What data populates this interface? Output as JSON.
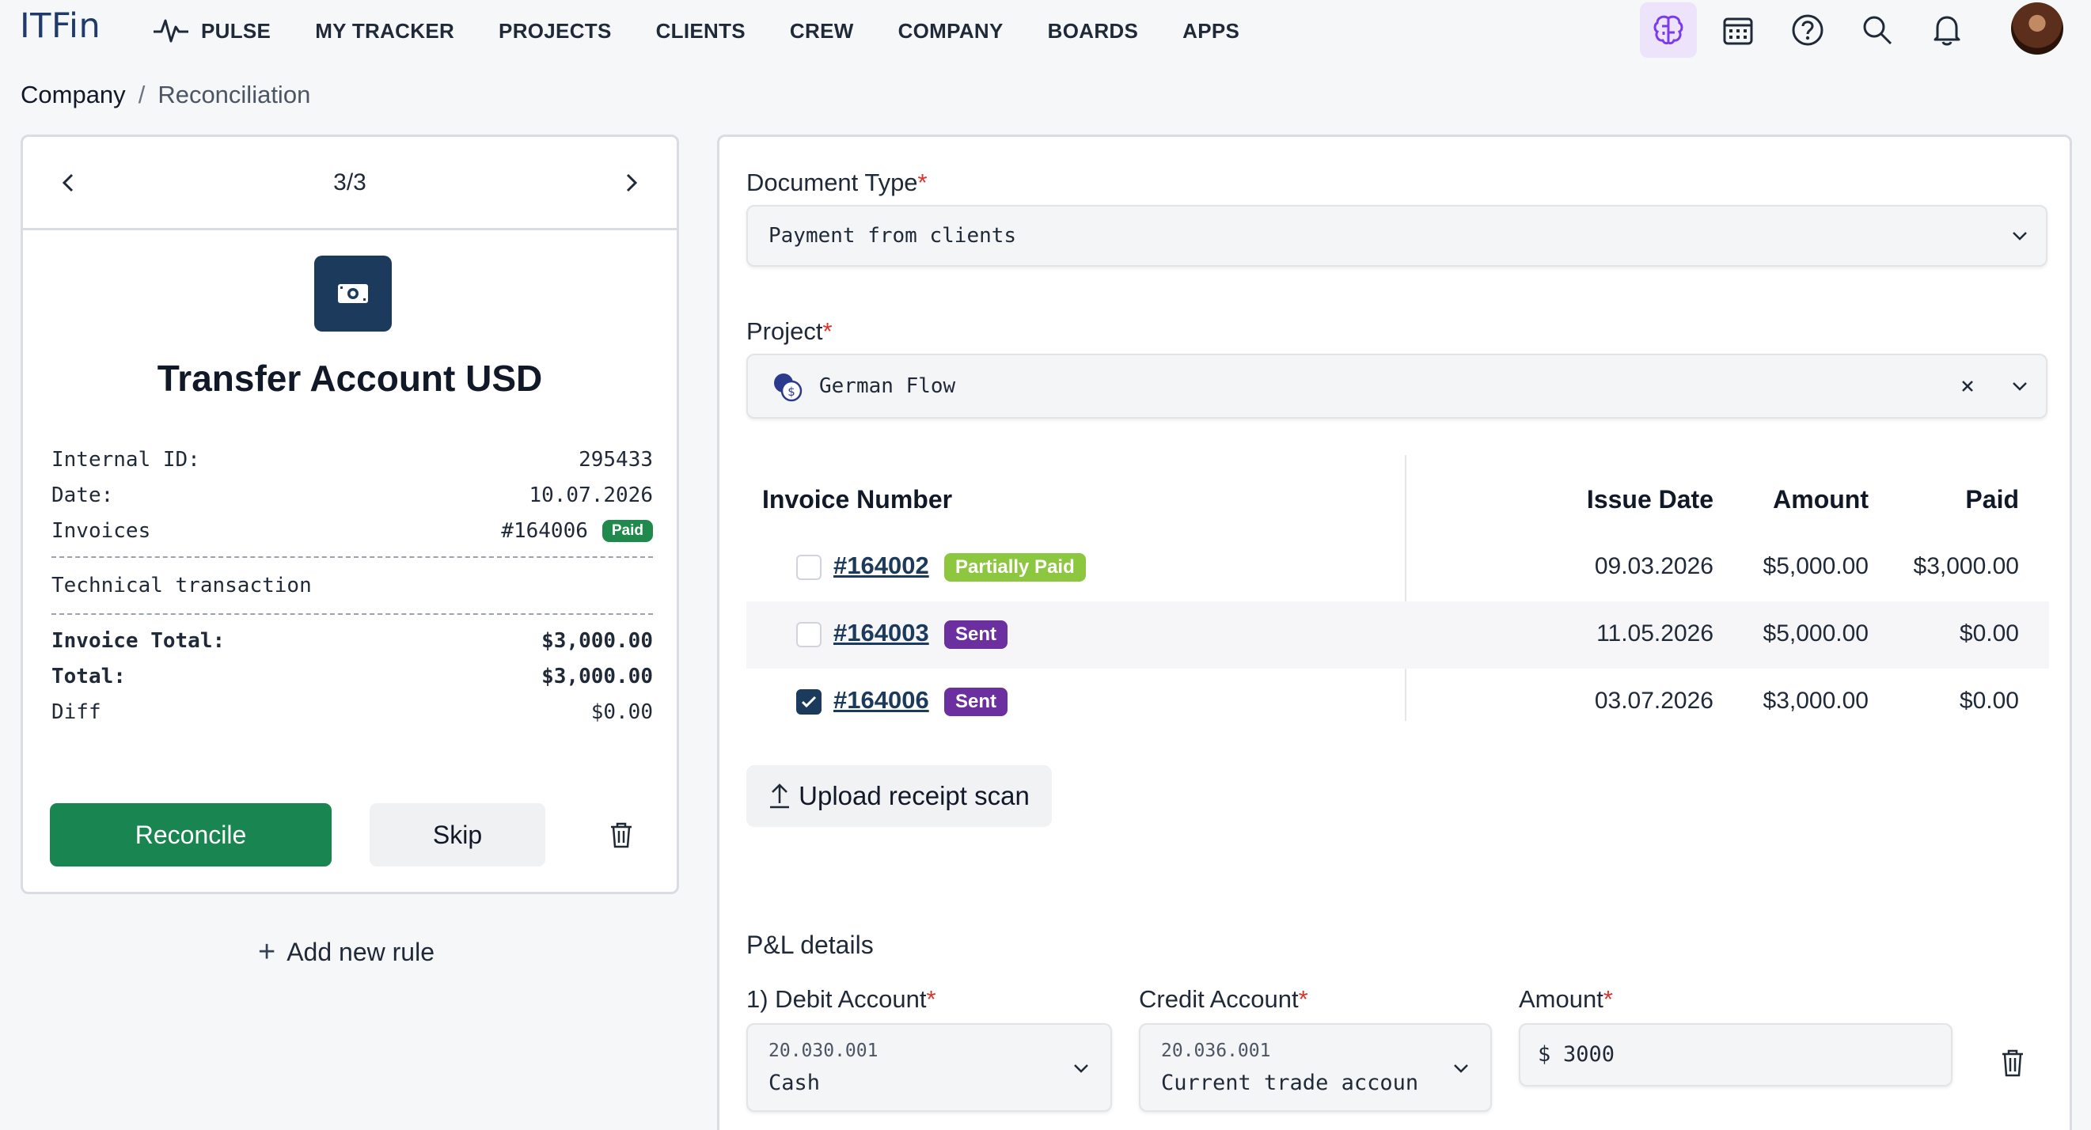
{
  "app": {
    "logo": "ITFin"
  },
  "nav": {
    "items": [
      {
        "label": "PULSE",
        "icon": "pulse-icon"
      },
      {
        "label": "MY TRACKER"
      },
      {
        "label": "PROJECTS"
      },
      {
        "label": "CLIENTS"
      },
      {
        "label": "CREW"
      },
      {
        "label": "COMPANY"
      },
      {
        "label": "BOARDS"
      },
      {
        "label": "APPS"
      }
    ],
    "icons": [
      "brain-icon",
      "calendar-icon",
      "help-icon",
      "search-icon",
      "bell-icon"
    ]
  },
  "breadcrumb": {
    "root": "Company",
    "separator": "/",
    "current": "Reconciliation"
  },
  "transaction": {
    "pager": "3/3",
    "account_name": "Transfer Account USD",
    "internal_id_label": "Internal ID:",
    "internal_id": "295433",
    "date_label": "Date:",
    "date": "10.07.2026",
    "invoices_label": "Invoices",
    "invoice_ref": "#164006",
    "invoice_badge": "Paid",
    "description": "Technical transaction",
    "invoice_total_label": "Invoice Total:",
    "invoice_total": "$3,000.00",
    "total_label": "Total:",
    "total": "$3,000.00",
    "diff_label": "Diff",
    "diff": "$0.00",
    "reconcile_label": "Reconcile",
    "skip_label": "Skip",
    "add_rule_label": "Add new rule"
  },
  "form": {
    "document_type_label": "Document Type",
    "document_type_value": "Payment from clients",
    "project_label": "Project",
    "project_value": "German Flow",
    "required_mark": "*",
    "table": {
      "headers": {
        "invoice": "Invoice Number",
        "issue_date": "Issue Date",
        "amount": "Amount",
        "paid": "Paid"
      },
      "rows": [
        {
          "number": "#164002",
          "status": "Partially Paid",
          "issue_date": "09.03.2026",
          "amount": "$5,000.00",
          "paid": "$3,000.00",
          "checked": false
        },
        {
          "number": "#164003",
          "status": "Sent",
          "issue_date": "11.05.2026",
          "amount": "$5,000.00",
          "paid": "$0.00",
          "checked": false
        },
        {
          "number": "#164006",
          "status": "Sent",
          "issue_date": "03.07.2026",
          "amount": "$3,000.00",
          "paid": "$0.00",
          "checked": true
        }
      ]
    },
    "upload_label": "Upload receipt scan",
    "pl_title": "P&L details",
    "debit_label": "1) Debit Account",
    "debit_code": "20.030.001",
    "debit_name": "Cash",
    "credit_label": "Credit Account",
    "credit_code": "20.036.001",
    "credit_name": "Current trade accoun",
    "amount_label": "Amount",
    "amount_currency": "$",
    "amount_value": "3000"
  },
  "colors": {
    "brand": "#1e3a6e",
    "reconcile": "#198550",
    "partial_badge": "#8dc63f",
    "sent_badge": "#6b2fa0",
    "paid_badge": "#1f8a4c",
    "required": "#d9342b"
  }
}
